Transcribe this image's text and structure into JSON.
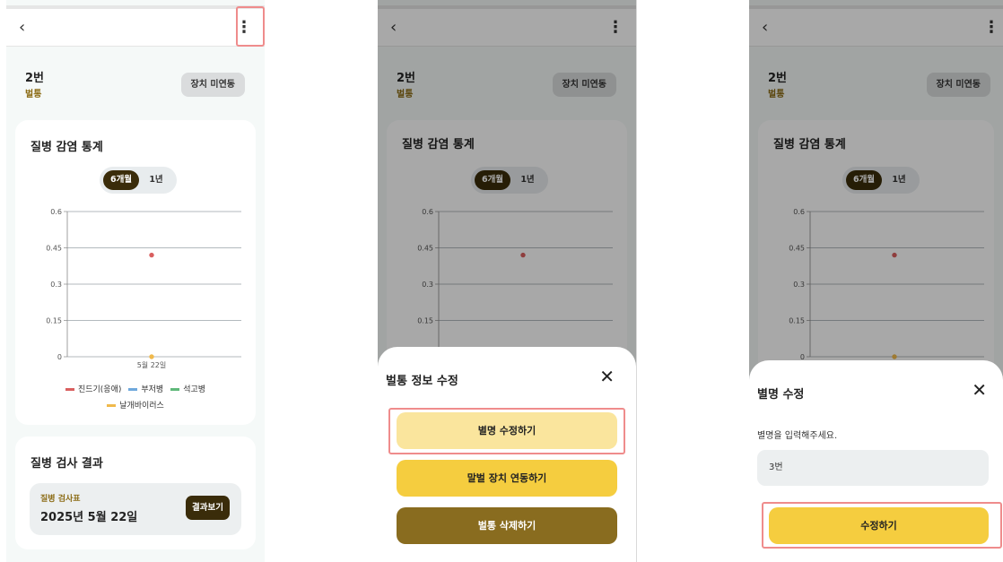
{
  "header": {
    "back_icon": "chevron-left-icon",
    "menu_icon": "kebab-vertical-icon",
    "back_glyph": "‹",
    "menu_glyph": "⋮"
  },
  "hive": {
    "name": "2번",
    "type": "벌통",
    "status_label": "장치 미연동"
  },
  "stats_card": {
    "title": "질병 감염 통계",
    "toggle": {
      "options": [
        "6개월",
        "1년"
      ],
      "selected": "6개월"
    }
  },
  "chart_data": {
    "type": "scatter",
    "categories": [
      "5월 22일"
    ],
    "yticks": [
      "0.6",
      "0.45",
      "0.3",
      "0.15",
      "0"
    ],
    "ylim": [
      0,
      0.6
    ],
    "grid": true,
    "series": [
      {
        "name": "진드기(응애)",
        "color": "#d95f5f",
        "values": [
          0.42
        ]
      },
      {
        "name": "부저병",
        "color": "#6fa8dc",
        "values": [
          null
        ]
      },
      {
        "name": "석고병",
        "color": "#5fb87a",
        "values": [
          null
        ]
      },
      {
        "name": "날개바이러스",
        "color": "#f0b94c",
        "values": [
          0
        ]
      }
    ],
    "legend_position": "bottom"
  },
  "result_card": {
    "title": "질병 검사 결과",
    "label": "질병 검사표",
    "date": "2025년 5월 22일",
    "button_label": "결과보기"
  },
  "edit_sheet": {
    "title": "벌통 정보 수정",
    "close_icon": "close-icon",
    "close_glyph": "✕",
    "buttons": [
      {
        "label": "별명 수정하기",
        "color": "#fae59d"
      },
      {
        "label": "말벌 장치 연동하기",
        "color": "#f5cd3f"
      },
      {
        "label": "벌통 삭제하기",
        "color": "#896c1f"
      }
    ]
  },
  "rename_sheet": {
    "title": "별명 수정",
    "close_glyph": "✕",
    "field_label": "별명을 입력해주세요.",
    "field_value": "3번",
    "submit_label": "수정하기",
    "submit_color": "#f5cd3f"
  },
  "colors": {
    "highlight": "#ef8c8c",
    "accent_dark": "#3a2c0a",
    "accent_text": "#8b6b14"
  }
}
